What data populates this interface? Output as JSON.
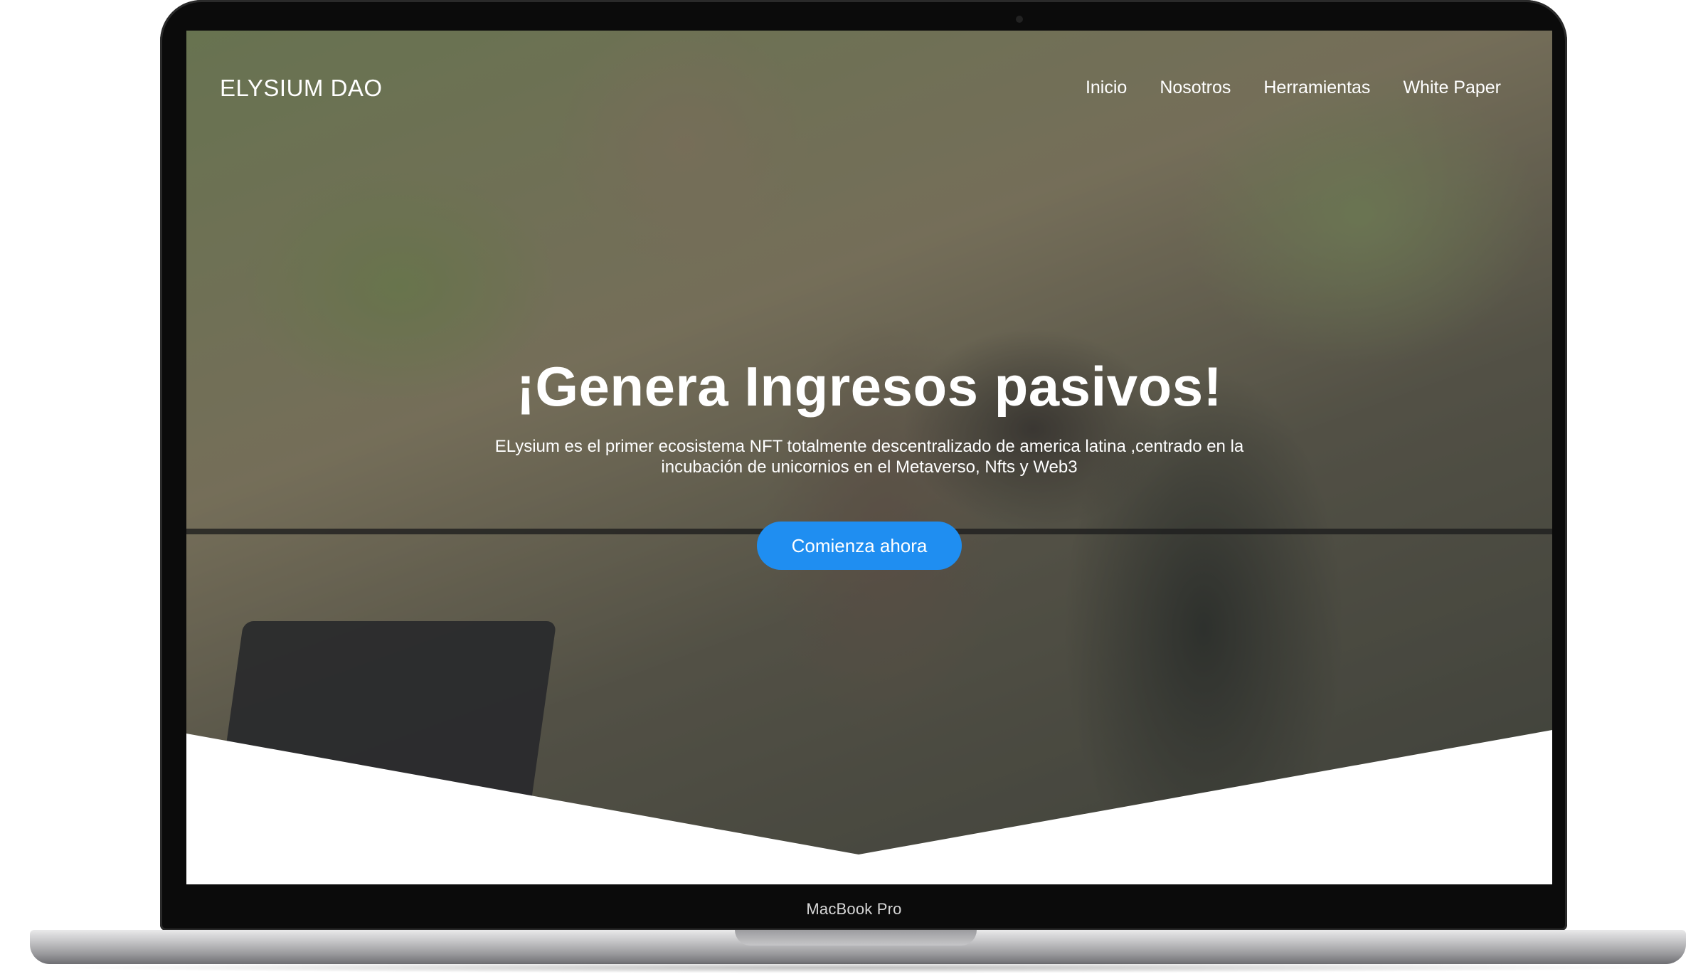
{
  "device": {
    "bezel_label": "MacBook Pro"
  },
  "site": {
    "brand": "ELYSIUM DAO",
    "nav": [
      {
        "label": "Inicio"
      },
      {
        "label": "Nosotros"
      },
      {
        "label": "Herramientas"
      },
      {
        "label": "White Paper"
      }
    ],
    "hero": {
      "title": "¡Genera Ingresos pasivos!",
      "subtitle_line1": "ELysium es el primer ecosistema NFT totalmente descentralizado de america latina ,centrado en la",
      "subtitle_line2": "incubación de unicornios en el Metaverso, Nfts y Web3",
      "cta_label": "Comienza ahora"
    },
    "colors": {
      "cta": "#1f8ef1",
      "text": "#ffffff",
      "bezel": "#0b0b0b"
    }
  }
}
